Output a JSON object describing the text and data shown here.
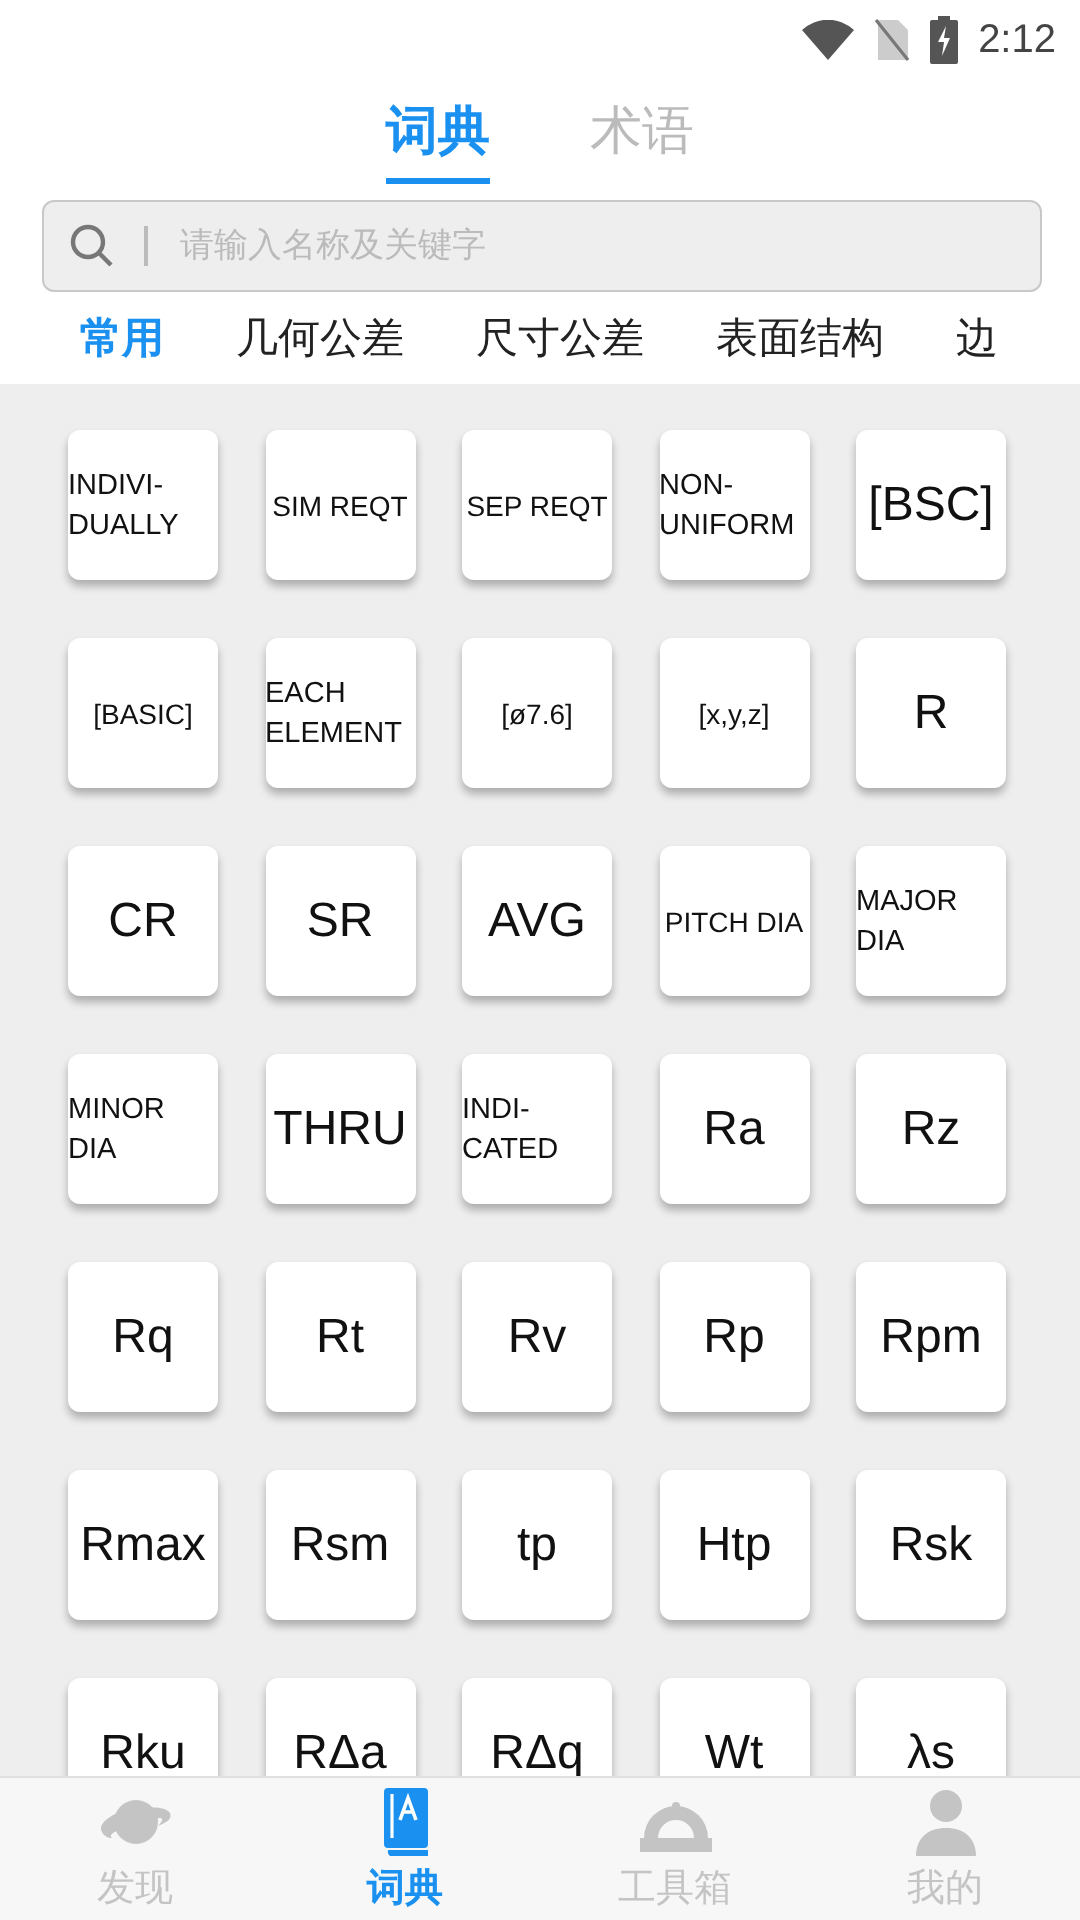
{
  "status_bar": {
    "time": "2:12"
  },
  "top_tabs": [
    {
      "label": "词典",
      "selected": true
    },
    {
      "label": "术语",
      "selected": false
    }
  ],
  "search": {
    "placeholder": "请输入名称及关键字"
  },
  "categories": [
    {
      "label": "常用",
      "selected": true
    },
    {
      "label": "几何公差",
      "selected": false
    },
    {
      "label": "尺寸公差",
      "selected": false
    },
    {
      "label": "表面结构",
      "selected": false
    },
    {
      "label": "边",
      "selected": false
    }
  ],
  "keys": [
    {
      "label": "INDIVI-DUALLY",
      "kind": "wrap"
    },
    {
      "label": "SIM REQT",
      "kind": "small"
    },
    {
      "label": "SEP REQT",
      "kind": "small"
    },
    {
      "label": "NON-UNIFORM",
      "kind": "wrap"
    },
    {
      "label": "[BSC]",
      "kind": "large"
    },
    {
      "label": "[BASIC]",
      "kind": "small"
    },
    {
      "label": "EACH ELEMENT",
      "kind": "wrap"
    },
    {
      "label": "[ø7.6]",
      "kind": "small"
    },
    {
      "label": "[x,y,z]",
      "kind": "small"
    },
    {
      "label": "R",
      "kind": "large"
    },
    {
      "label": "CR",
      "kind": "large"
    },
    {
      "label": "SR",
      "kind": "large"
    },
    {
      "label": "AVG",
      "kind": "large"
    },
    {
      "label": "PITCH DIA",
      "kind": "small"
    },
    {
      "label": "MAJOR DIA",
      "kind": "wrap"
    },
    {
      "label": "MINOR DIA",
      "kind": "wrap"
    },
    {
      "label": "THRU",
      "kind": "large"
    },
    {
      "label": "INDI-CATED",
      "kind": "wrap"
    },
    {
      "label": "Ra",
      "kind": "large"
    },
    {
      "label": "Rz",
      "kind": "large"
    },
    {
      "label": "Rq",
      "kind": "large"
    },
    {
      "label": "Rt",
      "kind": "large"
    },
    {
      "label": "Rv",
      "kind": "large"
    },
    {
      "label": "Rp",
      "kind": "large"
    },
    {
      "label": "Rpm",
      "kind": "large"
    },
    {
      "label": "Rmax",
      "kind": "large"
    },
    {
      "label": "Rsm",
      "kind": "large"
    },
    {
      "label": "tp",
      "kind": "large"
    },
    {
      "label": "Htp",
      "kind": "large"
    },
    {
      "label": "Rsk",
      "kind": "large"
    },
    {
      "label": "Rku",
      "kind": "large"
    },
    {
      "label": "RΔa",
      "kind": "large"
    },
    {
      "label": "RΔq",
      "kind": "large"
    },
    {
      "label": "Wt",
      "kind": "large"
    },
    {
      "label": "λs",
      "kind": "large"
    }
  ],
  "bottom_nav": [
    {
      "label": "发现",
      "selected": false
    },
    {
      "label": "词典",
      "selected": true
    },
    {
      "label": "工具箱",
      "selected": false
    },
    {
      "label": "我的",
      "selected": false
    }
  ]
}
